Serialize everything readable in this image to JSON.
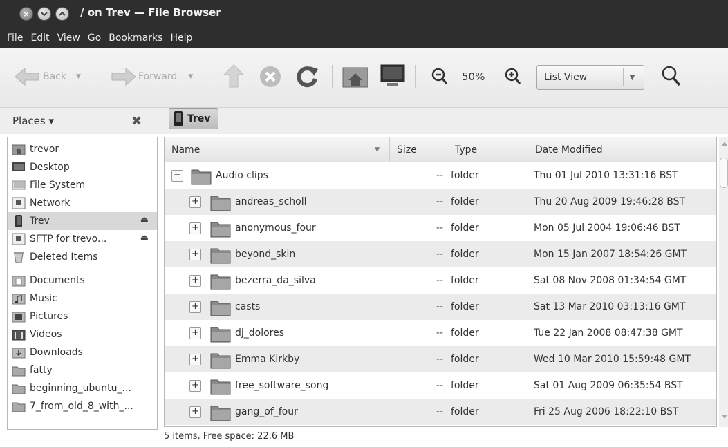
{
  "window": {
    "title": "/ on Trev — File Browser",
    "close_glyph": "×"
  },
  "menu": [
    "File",
    "Edit",
    "View",
    "Go",
    "Bookmarks",
    "Help"
  ],
  "toolbar": {
    "back_label": "Back",
    "forward_label": "Forward",
    "dropdown_glyph": "▼",
    "zoom_level": "50%",
    "view_mode": "List View"
  },
  "sidebar": {
    "header": "Places ▾",
    "close_glyph": "✖",
    "eject_glyph": "⏏",
    "items": [
      {
        "label": "trevor",
        "icon": "home-folder-icon"
      },
      {
        "label": "Desktop",
        "icon": "desktop-icon"
      },
      {
        "label": "File System",
        "icon": "filesystem-icon"
      },
      {
        "label": "Network",
        "icon": "network-icon"
      },
      {
        "label": "Trev",
        "icon": "phone-device-icon",
        "ejectable": true,
        "selected": true
      },
      {
        "label": "SFTP for trevo...",
        "icon": "network-share-icon",
        "ejectable": true
      },
      {
        "label": "Deleted Items",
        "icon": "trash-icon"
      },
      {
        "label": "Documents",
        "icon": "documents-folder-icon"
      },
      {
        "label": "Music",
        "icon": "music-folder-icon"
      },
      {
        "label": "Pictures",
        "icon": "pictures-folder-icon"
      },
      {
        "label": "Videos",
        "icon": "videos-folder-icon"
      },
      {
        "label": "Downloads",
        "icon": "downloads-folder-icon"
      },
      {
        "label": "fatty",
        "icon": "folder-icon"
      },
      {
        "label": "beginning_ubuntu_...",
        "icon": "folder-icon"
      },
      {
        "label": "7_from_old_8_with_...",
        "icon": "folder-icon"
      }
    ]
  },
  "pathbar": {
    "current": "Trev"
  },
  "filelist": {
    "columns": [
      "Name",
      "Size",
      "Type",
      "Date Modified"
    ],
    "sort_glyph": "▼",
    "rows": [
      {
        "name": "Audio clips",
        "size": "--",
        "type": "folder",
        "modified": "Thu 01 Jul 2010 13:31:16 BST",
        "expanded": true,
        "level": 0,
        "expander": "−"
      },
      {
        "name": "andreas_scholl",
        "size": "--",
        "type": "folder",
        "modified": "Thu 20 Aug 2009 19:46:28 BST",
        "level": 1,
        "expander": "+"
      },
      {
        "name": "anonymous_four",
        "size": "--",
        "type": "folder",
        "modified": "Mon 05 Jul 2004 19:06:46 BST",
        "level": 1,
        "expander": "+"
      },
      {
        "name": "beyond_skin",
        "size": "--",
        "type": "folder",
        "modified": "Mon 15 Jan 2007 18:54:26 GMT",
        "level": 1,
        "expander": "+"
      },
      {
        "name": "bezerra_da_silva",
        "size": "--",
        "type": "folder",
        "modified": "Sat 08 Nov 2008 01:34:54 GMT",
        "level": 1,
        "expander": "+"
      },
      {
        "name": "casts",
        "size": "--",
        "type": "folder",
        "modified": "Sat 13 Mar 2010 03:13:16 GMT",
        "level": 1,
        "expander": "+"
      },
      {
        "name": "dj_dolores",
        "size": "--",
        "type": "folder",
        "modified": "Tue 22 Jan 2008 08:47:38 GMT",
        "level": 1,
        "expander": "+"
      },
      {
        "name": "Emma Kirkby",
        "size": "--",
        "type": "folder",
        "modified": "Wed 10 Mar 2010 15:59:48 GMT",
        "level": 1,
        "expander": "+"
      },
      {
        "name": "free_software_song",
        "size": "--",
        "type": "folder",
        "modified": "Sat 01 Aug 2009 06:35:54 BST",
        "level": 1,
        "expander": "+"
      },
      {
        "name": "gang_of_four",
        "size": "--",
        "type": "folder",
        "modified": "Fri 25 Aug 2006 18:22:10 BST",
        "level": 1,
        "expander": "+"
      }
    ]
  },
  "status": "5 items, Free space: 22.6 MB"
}
